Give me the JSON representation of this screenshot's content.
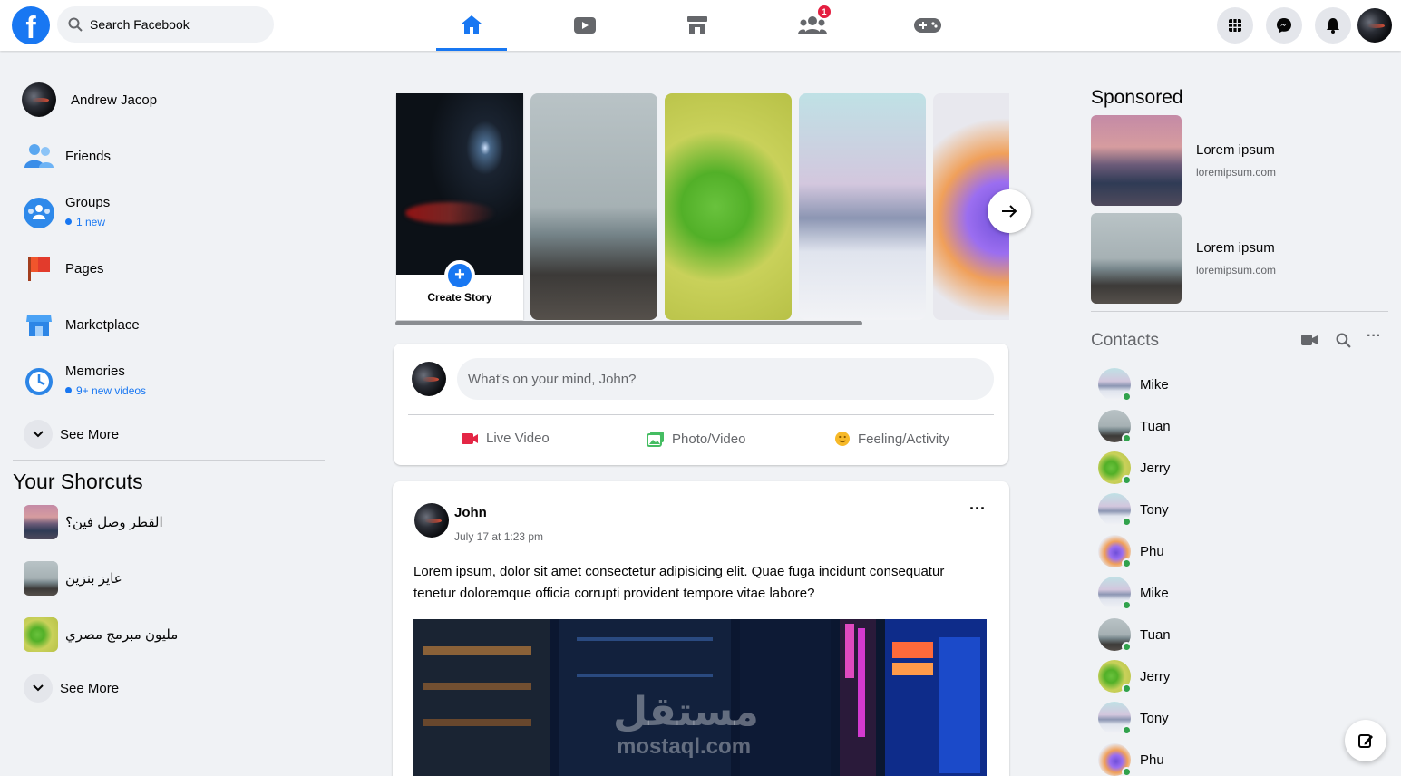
{
  "app": {
    "brand_color": "#1877f2"
  },
  "header": {
    "logo_letter": "f",
    "search_placeholder": "Search Facebook",
    "tabs": [
      {
        "name": "home",
        "icon": "home-icon",
        "active": true
      },
      {
        "name": "watch",
        "icon": "video-play-icon",
        "active": false
      },
      {
        "name": "marketplace",
        "icon": "store-icon",
        "active": false
      },
      {
        "name": "groups",
        "icon": "people-icon",
        "active": false,
        "badge": "1"
      },
      {
        "name": "gaming",
        "icon": "gamepad-icon",
        "active": false
      }
    ],
    "right_icons": [
      "grid-menu-icon",
      "messenger-icon",
      "bell-icon",
      "profile-avatar"
    ]
  },
  "sidebar": {
    "profile_name": "Andrew Jacop",
    "items": [
      {
        "label": "Friends",
        "icon": "friends-icon"
      },
      {
        "label": "Groups",
        "icon": "groups-icon",
        "sub": "1 new"
      },
      {
        "label": "Pages",
        "icon": "flag-icon"
      },
      {
        "label": "Marketplace",
        "icon": "store-icon"
      },
      {
        "label": "Memories",
        "icon": "clock-icon",
        "sub": "9+ new videos"
      }
    ],
    "see_more": "See More",
    "shortcuts_title": "Your Shorcuts",
    "shortcuts": [
      {
        "label": "القطر وصل فين؟"
      },
      {
        "label": "عايز بنزين"
      },
      {
        "label": "مليون مبرمج مصري"
      }
    ],
    "shortcuts_see_more": "See More"
  },
  "stories": {
    "create_label": "Create Story",
    "plus": "+"
  },
  "composer": {
    "placeholder": "What's on your mind, John?",
    "actions": [
      {
        "label": "Live Video",
        "icon": "live-video-icon",
        "color": "#e42645"
      },
      {
        "label": "Photo/Video",
        "icon": "photo-icon",
        "color": "#45bd62"
      },
      {
        "label": "Feeling/Activity",
        "icon": "smile-icon",
        "color": "#f7b928"
      }
    ]
  },
  "post": {
    "author": "John",
    "time": "July 17 at 1:23 pm",
    "text": "Lorem ipsum, dolor sit amet consectetur adipisicing elit. Quae fuga incidunt consequatur tenetur doloremque officia corrupti provident tempore vitae labore?",
    "more": "···"
  },
  "sponsored": {
    "title": "Sponsored",
    "items": [
      {
        "name": "Lorem ipsum",
        "url": "loremipsum.com"
      },
      {
        "name": "Lorem ipsum",
        "url": "loremipsum.com"
      }
    ]
  },
  "contacts": {
    "title": "Contacts",
    "more": "···",
    "list": [
      {
        "name": "Mike"
      },
      {
        "name": "Tuan"
      },
      {
        "name": "Jerry"
      },
      {
        "name": "Tony"
      },
      {
        "name": "Phu"
      },
      {
        "name": "Mike"
      },
      {
        "name": "Tuan"
      },
      {
        "name": "Jerry"
      },
      {
        "name": "Tony"
      },
      {
        "name": "Phu"
      }
    ]
  },
  "watermark": {
    "arabic": "مستقل",
    "latin": "mostaql.com"
  }
}
